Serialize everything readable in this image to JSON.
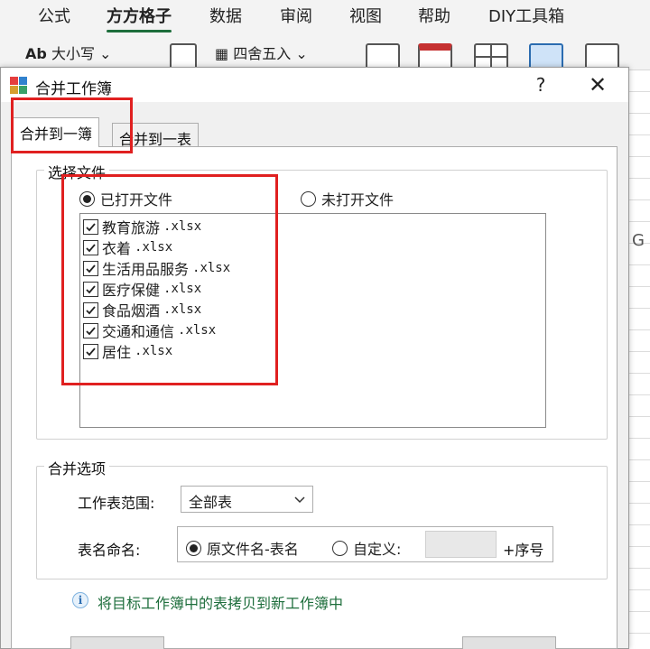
{
  "ribbon": {
    "tabs": [
      "公式",
      "方方格子",
      "数据",
      "审阅",
      "视图",
      "帮助",
      "DIY工具箱"
    ],
    "active_tab": "方方格子",
    "case_button": "大小写",
    "case_prefix": "Ab",
    "round_button": "四舍五入"
  },
  "sheet": {
    "column_letter": "G"
  },
  "dialog": {
    "title": "合并工作簿",
    "help": "?",
    "close": "✕",
    "tabs": [
      "合并到一簿",
      "合并到一表"
    ],
    "select_files": {
      "title": "选择文件",
      "radio_open": "已打开文件",
      "radio_unopened": "未打开文件",
      "selected": "已打开文件",
      "files": [
        {
          "name": "教育旅游",
          "ext": ".xlsx",
          "checked": true
        },
        {
          "name": "衣着",
          "ext": ".xlsx",
          "checked": true
        },
        {
          "name": "生活用品服务",
          "ext": ".xlsx",
          "checked": true
        },
        {
          "name": "医疗保健",
          "ext": ".xlsx",
          "checked": true
        },
        {
          "name": "食品烟酒",
          "ext": ".xlsx",
          "checked": true
        },
        {
          "name": "交通和通信",
          "ext": ".xlsx",
          "checked": true
        },
        {
          "name": "居住",
          "ext": ".xlsx",
          "checked": true
        }
      ]
    },
    "merge_options": {
      "title": "合并选项",
      "range_label": "工作表范围:",
      "range_value": "全部表",
      "naming_label": "表名命名:",
      "naming_original": "原文件名-表名",
      "naming_custom": "自定义:",
      "custom_value": "",
      "suffix": "+序号",
      "naming_selected": "原文件名-表名"
    },
    "info": "将目标工作簿中的表拷贝到新工作簿中"
  },
  "colors": {
    "highlight": "#e02020",
    "info_text": "#1e6e3c",
    "active_tab_underline": "#1e6e3c"
  }
}
